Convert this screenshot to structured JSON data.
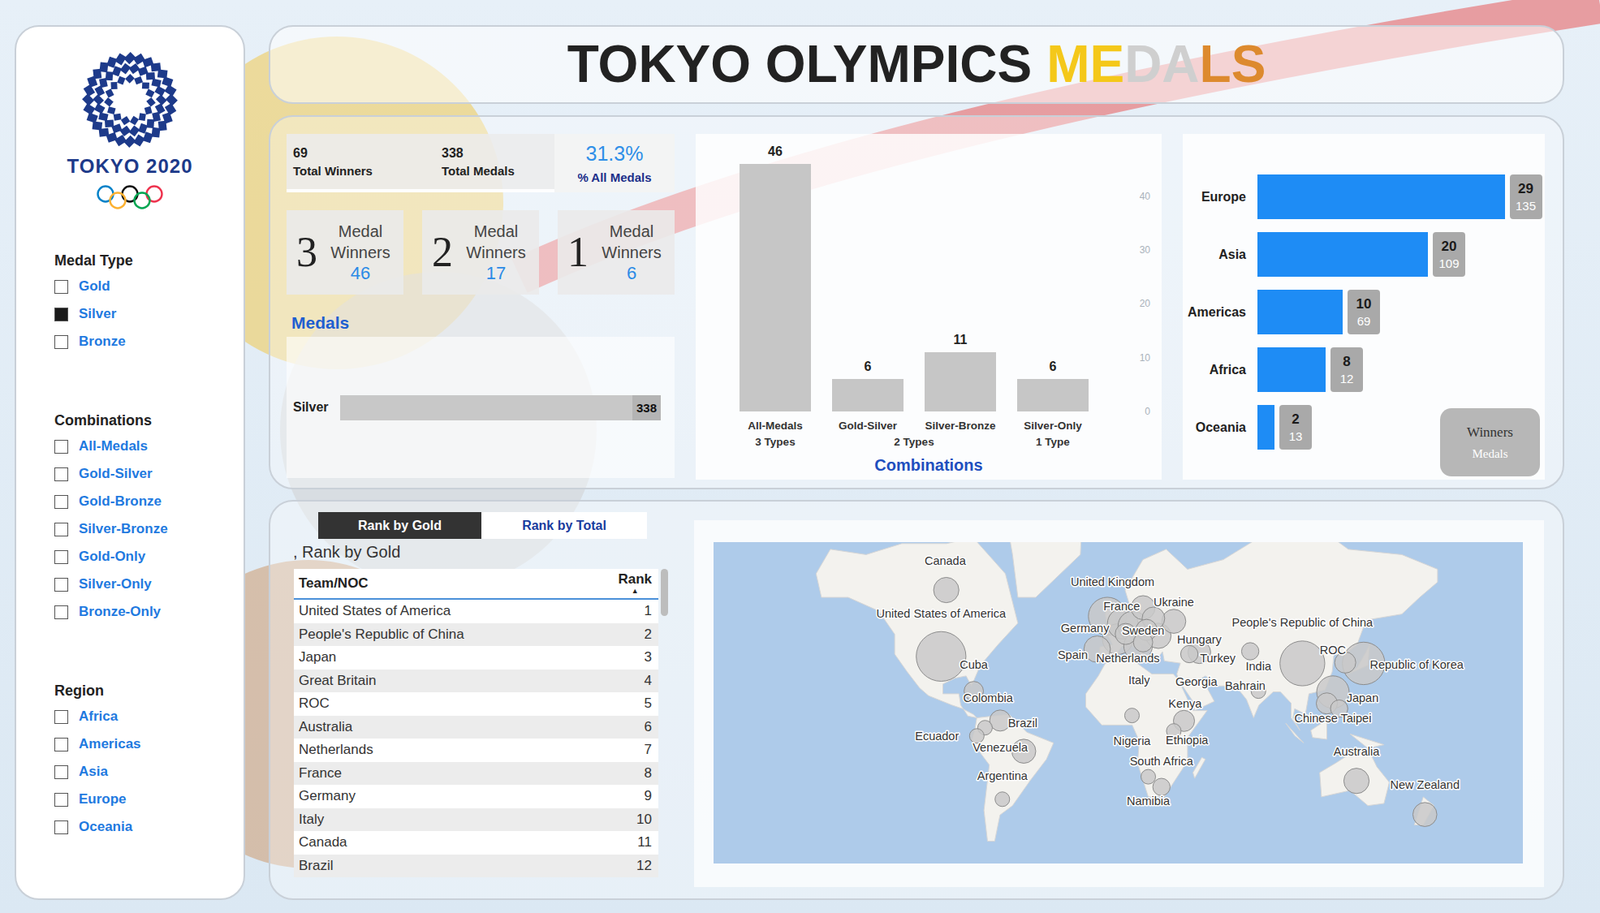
{
  "title": {
    "words": [
      {
        "parts": [
          {
            "text": "TOKYO OLYMPICS",
            "color": "#222222"
          }
        ]
      },
      {
        "parts": [
          {
            "text": "ME",
            "color": "#f4c81a"
          },
          {
            "text": "DA",
            "color": "#cfcfcf"
          },
          {
            "text": "LS",
            "color": "#dd8a2e"
          }
        ]
      }
    ]
  },
  "logo": {
    "text": "TOKYO 2020"
  },
  "sidebar": {
    "filters": [
      {
        "title": "Medal Type",
        "options": [
          {
            "label": "Gold",
            "checked": false
          },
          {
            "label": "Silver",
            "checked": true
          },
          {
            "label": "Bronze",
            "checked": false
          }
        ]
      },
      {
        "title": "Combinations",
        "options": [
          {
            "label": "All-Medals",
            "checked": false
          },
          {
            "label": "Gold-Silver",
            "checked": false
          },
          {
            "label": "Gold-Bronze",
            "checked": false
          },
          {
            "label": "Silver-Bronze",
            "checked": false
          },
          {
            "label": "Gold-Only",
            "checked": false
          },
          {
            "label": "Silver-Only",
            "checked": false
          },
          {
            "label": "Bronze-Only",
            "checked": false
          }
        ]
      },
      {
        "title": "Region",
        "options": [
          {
            "label": "Africa",
            "checked": false
          },
          {
            "label": "Americas",
            "checked": false
          },
          {
            "label": "Asia",
            "checked": false
          },
          {
            "label": "Europe",
            "checked": false
          },
          {
            "label": "Oceania",
            "checked": false
          }
        ]
      }
    ]
  },
  "kpis": [
    {
      "kind": "count",
      "value": "69",
      "label": "Total Winners"
    },
    {
      "kind": "count",
      "value": "338",
      "label": "Total Medals"
    },
    {
      "kind": "percent",
      "value": "31.3%",
      "label": "% All Medals"
    }
  ],
  "winner_cards": [
    {
      "digit": "3",
      "label": "Medal Winners",
      "value": "46"
    },
    {
      "digit": "2",
      "label": "Medal Winners",
      "value": "17"
    },
    {
      "digit": "1",
      "label": "Medal Winners",
      "value": "6"
    }
  ],
  "medals_chart": {
    "title": "Medals",
    "bars": [
      {
        "label": "Silver",
        "value": 338,
        "reading": "338"
      }
    ]
  },
  "combinations_chart": {
    "title": "Combinations",
    "ticks": [
      "40",
      "30",
      "20",
      "10",
      "0"
    ],
    "bars": [
      {
        "label": "All-Medals",
        "group": "3 Types",
        "value": 46,
        "reading": "46"
      },
      {
        "label": "Gold-Silver",
        "group": "2 Types",
        "value": 6,
        "reading": "6"
      },
      {
        "label": "Silver-Bronze",
        "group": "2 Types",
        "value": 11,
        "reading": "11"
      },
      {
        "label": "Silver-Only",
        "group": "1 Type",
        "value": 6,
        "reading": "6"
      }
    ]
  },
  "regions_chart": {
    "legend": [
      "Winners",
      "Medals"
    ],
    "rows": [
      {
        "label": "Europe",
        "winners": 29,
        "medals": 135,
        "winners_text": "29",
        "medals_text": "135"
      },
      {
        "label": "Asia",
        "winners": 20,
        "medals": 109,
        "winners_text": "20",
        "medals_text": "109"
      },
      {
        "label": "Americas",
        "winners": 10,
        "medals": 69,
        "winners_text": "10",
        "medals_text": "69"
      },
      {
        "label": "Africa",
        "winners": 8,
        "medals": 12,
        "winners_text": "8",
        "medals_text": "12"
      },
      {
        "label": "Oceania",
        "winners": 2,
        "medals": 13,
        "winners_text": "2",
        "medals_text": "13"
      }
    ]
  },
  "rank_tabs": [
    {
      "label": "Rank by Gold",
      "selected": true
    },
    {
      "label": "Rank by Total",
      "selected": false
    }
  ],
  "table": {
    "caption": ", Rank by Gold",
    "columns": [
      {
        "label": "Team/NOC"
      },
      {
        "label": "Rank",
        "sort_icon": "▲"
      }
    ],
    "rows": [
      [
        "United States of America",
        "1"
      ],
      [
        "People's Republic of China",
        "2"
      ],
      [
        "Japan",
        "3"
      ],
      [
        "Great Britain",
        "4"
      ],
      [
        "ROC",
        "5"
      ],
      [
        "Australia",
        "6"
      ],
      [
        "Netherlands",
        "7"
      ],
      [
        "France",
        "8"
      ],
      [
        "Germany",
        "9"
      ],
      [
        "Italy",
        "10"
      ],
      [
        "Canada",
        "11"
      ],
      [
        "Brazil",
        "12"
      ]
    ]
  },
  "map": {
    "labels": [
      {
        "text": "Canada",
        "lon": -95.7,
        "lat": 68.8
      },
      {
        "text": "United Kingdom",
        "lon": -2.0,
        "lat": 64.1
      },
      {
        "text": "United States of America",
        "lon": -98.0,
        "lat": 55.2
      },
      {
        "text": "France",
        "lon": 3.1,
        "lat": 57.4
      },
      {
        "text": "Ukraine",
        "lon": 32.3,
        "lat": 58.6
      },
      {
        "text": "Germany",
        "lon": -17.4,
        "lat": 50.3
      },
      {
        "text": "Sweden",
        "lon": 15.1,
        "lat": 49.2
      },
      {
        "text": "Hungary",
        "lon": 46.6,
        "lat": 46.1
      },
      {
        "text": "People's Republic of China",
        "lon": 104.3,
        "lat": 52.1
      },
      {
        "text": "ROC",
        "lon": 121.4,
        "lat": 41.6
      },
      {
        "text": "Spain",
        "lon": -24.3,
        "lat": 39.5
      },
      {
        "text": "Netherlands",
        "lon": 6.6,
        "lat": 38.1
      },
      {
        "text": "Turkey",
        "lon": 56.9,
        "lat": 38.1
      },
      {
        "text": "India",
        "lon": 79.7,
        "lat": 34.4
      },
      {
        "text": "Republic of Korea",
        "lon": 168.3,
        "lat": 35.4
      },
      {
        "text": "Cuba",
        "lon": -79.7,
        "lat": 35.4
      },
      {
        "text": "Italy",
        "lon": 12.9,
        "lat": 28.1
      },
      {
        "text": "Georgia",
        "lon": 44.9,
        "lat": 27.1
      },
      {
        "text": "Bahrain",
        "lon": 72.3,
        "lat": 25.1
      },
      {
        "text": "Colombia",
        "lon": -71.7,
        "lat": 18.7
      },
      {
        "text": "Japan",
        "lon": 138.0,
        "lat": 18.7
      },
      {
        "text": "Kenya",
        "lon": 38.6,
        "lat": 15.9
      },
      {
        "text": "Chinese Taipei",
        "lon": 121.4,
        "lat": 7.6
      },
      {
        "text": "Brazil",
        "lon": -52.3,
        "lat": 5.3
      },
      {
        "text": "Ecuador",
        "lon": -100.3,
        "lat": -2.1
      },
      {
        "text": "Nigeria",
        "lon": 8.9,
        "lat": -5.0
      },
      {
        "text": "Ethiopia",
        "lon": 39.7,
        "lat": -4.4
      },
      {
        "text": "Venezuela",
        "lon": -64.9,
        "lat": -8.4
      },
      {
        "text": "Australia",
        "lon": 134.6,
        "lat": -10.6
      },
      {
        "text": "South Africa",
        "lon": 25.4,
        "lat": -16.2
      },
      {
        "text": "Argentina",
        "lon": -63.7,
        "lat": -23.7
      },
      {
        "text": "New Zealand",
        "lon": 172.9,
        "lat": -28.3
      },
      {
        "text": "Namibia",
        "lon": 18.0,
        "lat": -36.0
      }
    ],
    "bubbles": [
      {
        "lon": -98,
        "lat": 39,
        "value": 41
      },
      {
        "lon": 104.3,
        "lat": 35.9,
        "value": 32
      },
      {
        "lon": 138.6,
        "lat": 35.9,
        "value": 28
      },
      {
        "lon": 121.4,
        "lat": 21.9,
        "value": 14
      },
      {
        "lon": -95.1,
        "lat": 62,
        "value": 7
      },
      {
        "lon": -79.7,
        "lat": 22.4,
        "value": 3
      },
      {
        "lon": -64.9,
        "lat": 6.5,
        "value": 4
      },
      {
        "lon": -73.4,
        "lat": 2.5,
        "value": 1
      },
      {
        "lon": -78,
        "lat": -2.1,
        "value": 1
      },
      {
        "lon": -51.7,
        "lat": -10.6,
        "value": 6
      },
      {
        "lon": -63.7,
        "lat": -35.1,
        "value": 1
      },
      {
        "lon": 8.9,
        "lat": 9.3,
        "value": 1
      },
      {
        "lon": 32.3,
        "lat": 0.7,
        "value": 1
      },
      {
        "lon": 38,
        "lat": 6.3,
        "value": 4
      },
      {
        "lon": 18,
        "lat": -24.2,
        "value": 1
      },
      {
        "lon": 25.4,
        "lat": -29.3,
        "value": 2
      },
      {
        "lon": 134.6,
        "lat": -26.3,
        "value": 7
      },
      {
        "lon": 172.9,
        "lat": -41.8,
        "value": 6
      },
      {
        "lon": -4.9,
        "lat": 54.3,
        "value": 21
      },
      {
        "lon": 0.9,
        "lat": 46.1,
        "value": 12
      },
      {
        "lon": 3.7,
        "lat": 51.8,
        "value": 12
      },
      {
        "lon": 9.4,
        "lat": 51,
        "value": 11
      },
      {
        "lon": 15.1,
        "lat": 57,
        "value": 6
      },
      {
        "lon": 12.3,
        "lat": 43.4,
        "value": 10
      },
      {
        "lon": -10.6,
        "lat": 42.1,
        "value": 8
      },
      {
        "lon": 23.7,
        "lat": 47.4,
        "value": 7
      },
      {
        "lon": 20.9,
        "lat": 53.6,
        "value": 5
      },
      {
        "lon": 32.3,
        "lat": 52.6,
        "value": 6
      },
      {
        "lon": 17,
        "lat": 49.6,
        "value": 4
      },
      {
        "lon": 41,
        "lat": 40,
        "value": 2
      },
      {
        "lon": 46.6,
        "lat": 40.8,
        "value": 5
      },
      {
        "lon": 79.7,
        "lat": 22.4,
        "value": 1
      },
      {
        "lon": 75.1,
        "lat": 41.2,
        "value": 2
      },
      {
        "lon": 128.3,
        "lat": 36.3,
        "value": 4
      },
      {
        "lon": 118,
        "lat": 15.9,
        "value": 4
      },
      {
        "lon": 124.9,
        "lat": 13.1,
        "value": 2
      },
      {
        "lon": 15.1,
        "lat": 44.9,
        "value": 3
      },
      {
        "lon": 5.4,
        "lat": 48.1,
        "value": 4
      }
    ]
  }
}
